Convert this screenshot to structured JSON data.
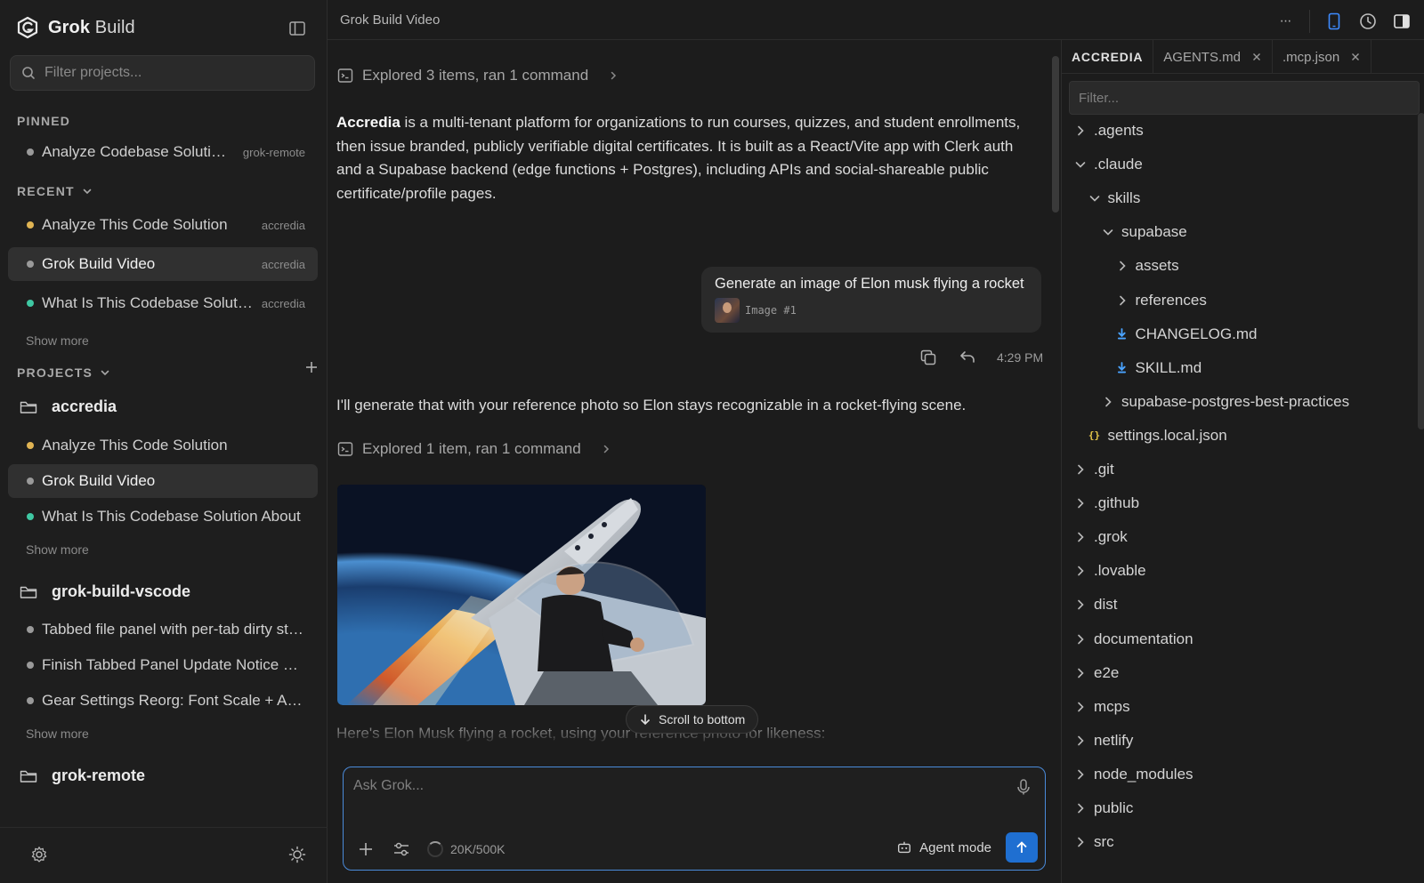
{
  "app": {
    "brand_bold": "Grok",
    "brand_light": " Build"
  },
  "sidebar": {
    "filter_placeholder": "Filter projects...",
    "pinned_title": "PINNED",
    "pinned": [
      {
        "title": "Analyze Codebase Solution ...",
        "tag": "grok-remote",
        "dot": "#9a9a9a"
      }
    ],
    "recent_title": "RECENT",
    "recent": [
      {
        "title": "Analyze This Code Solution",
        "tag": "accredia",
        "dot": "#e0b453"
      },
      {
        "title": "Grok Build Video",
        "tag": "accredia",
        "dot": "#9a9a9a"
      },
      {
        "title": "What Is This Codebase Solution...",
        "tag": "accredia",
        "dot": "#3fc8a3"
      }
    ],
    "recent_show_more": "Show more",
    "projects_title": "PROJECTS",
    "projects": [
      {
        "name": "accredia",
        "items": [
          {
            "title": "Analyze This Code Solution",
            "dot": "#e0b453"
          },
          {
            "title": "Grok Build Video",
            "dot": "#9a9a9a"
          },
          {
            "title": "What Is This Codebase Solution About",
            "dot": "#3fc8a3"
          }
        ],
        "show_more": "Show more"
      },
      {
        "name": "grok-build-vscode",
        "items": [
          {
            "title": "Tabbed file panel with per-tab dirty state",
            "dot": "#9a9a9a"
          },
          {
            "title": "Finish Tabbed Panel Update Notice Fixes",
            "dot": "#9a9a9a"
          },
          {
            "title": "Gear Settings Reorg: Font Scale + Adva...",
            "dot": "#9a9a9a"
          }
        ],
        "show_more": "Show more"
      },
      {
        "name": "grok-remote",
        "items": []
      }
    ]
  },
  "topbar": {
    "title": "Grok Build Video",
    "more": "···"
  },
  "chat": {
    "explored_1": "Explored 3 items, ran 1 command",
    "intro_bold": "Accredia",
    "intro_rest": " is a multi-tenant platform for organizations to run courses, quizzes, and student enrollments, then issue branded, publicly verifiable digital certificates. It is built as a React/Vite app with Clerk auth and a Supabase backend (edge functions + Postgres), including APIs and social-shareable public certificate/profile pages.",
    "user_message": "Generate an image of Elon musk flying a rocket",
    "attachment_label": "Image #1",
    "message_time": "4:29 PM",
    "reply": "I'll generate that with your reference photo so Elon stays recognizable in a rocket-flying scene.",
    "explored_2": "Explored 1 item, ran 1 command",
    "faded_line": "Here's Elon Musk flying a rocket, using your reference photo for likeness:",
    "scroll_to_bottom": "Scroll to bottom"
  },
  "composer": {
    "placeholder": "Ask Grok...",
    "tokens": "20K/500K",
    "agent_mode": "Agent mode",
    "accent": "#1f6fd1"
  },
  "panel": {
    "tabs": [
      {
        "label": "ACCREDIA",
        "closable": false
      },
      {
        "label": "AGENTS.md",
        "closable": true
      },
      {
        "label": ".mcp.json",
        "closable": true
      }
    ],
    "filter_placeholder": "Filter...",
    "tree": [
      {
        "label": ".agents",
        "kind": "folder",
        "open": false,
        "depth": 0
      },
      {
        "label": ".claude",
        "kind": "folder",
        "open": true,
        "depth": 0
      },
      {
        "label": "skills",
        "kind": "folder",
        "open": true,
        "depth": 1
      },
      {
        "label": "supabase",
        "kind": "folder",
        "open": true,
        "depth": 2
      },
      {
        "label": "assets",
        "kind": "folder",
        "open": false,
        "depth": 3
      },
      {
        "label": "references",
        "kind": "folder",
        "open": false,
        "depth": 3
      },
      {
        "label": "CHANGELOG.md",
        "kind": "md",
        "depth": 3
      },
      {
        "label": "SKILL.md",
        "kind": "md",
        "depth": 3
      },
      {
        "label": "supabase-postgres-best-practices",
        "kind": "folder",
        "open": false,
        "depth": 2
      },
      {
        "label": "settings.local.json",
        "kind": "json",
        "depth": 1
      },
      {
        "label": ".git",
        "kind": "folder",
        "open": false,
        "depth": 0
      },
      {
        "label": ".github",
        "kind": "folder",
        "open": false,
        "depth": 0
      },
      {
        "label": ".grok",
        "kind": "folder",
        "open": false,
        "depth": 0
      },
      {
        "label": ".lovable",
        "kind": "folder",
        "open": false,
        "depth": 0
      },
      {
        "label": "dist",
        "kind": "folder",
        "open": false,
        "depth": 0
      },
      {
        "label": "documentation",
        "kind": "folder",
        "open": false,
        "depth": 0
      },
      {
        "label": "e2e",
        "kind": "folder",
        "open": false,
        "depth": 0
      },
      {
        "label": "mcps",
        "kind": "folder",
        "open": false,
        "depth": 0
      },
      {
        "label": "netlify",
        "kind": "folder",
        "open": false,
        "depth": 0
      },
      {
        "label": "node_modules",
        "kind": "folder",
        "open": false,
        "depth": 0
      },
      {
        "label": "public",
        "kind": "folder",
        "open": false,
        "depth": 0
      },
      {
        "label": "src",
        "kind": "folder",
        "open": false,
        "depth": 0
      }
    ]
  }
}
